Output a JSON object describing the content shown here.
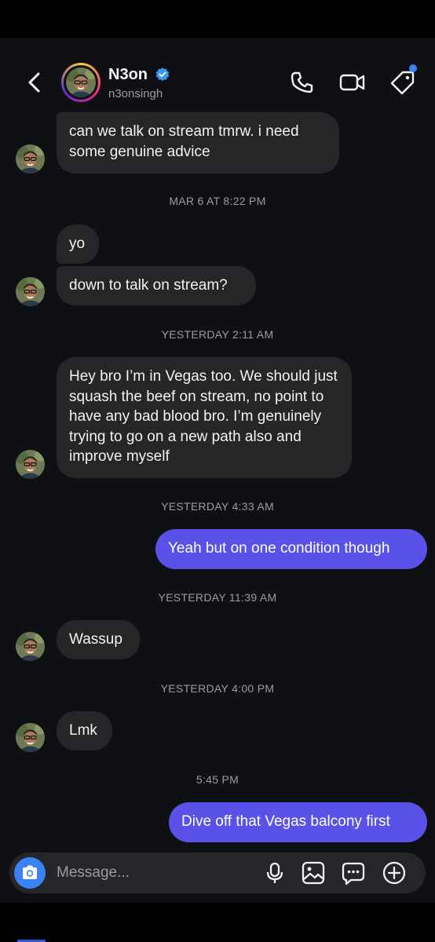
{
  "header": {
    "name": "N3on",
    "handle": "n3onsingh"
  },
  "messages": [
    {
      "dir": "in",
      "text": "can we talk on stream tmrw. i need some genuine advice"
    },
    {
      "dir": "ts",
      "text": "MAR 6 AT 8:22 PM"
    },
    {
      "dir": "in",
      "text": "yo"
    },
    {
      "dir": "in",
      "text": "down to talk on stream?"
    },
    {
      "dir": "ts",
      "text": "YESTERDAY 2:11 AM"
    },
    {
      "dir": "in",
      "text": "Hey bro I’m in Vegas too. We should just squash the beef on stream, no point to have any bad blood bro. I’m genuinely trying to go on a new path also and improve myself"
    },
    {
      "dir": "ts",
      "text": "YESTERDAY 4:33 AM"
    },
    {
      "dir": "out",
      "text": "Yeah but on one condition though"
    },
    {
      "dir": "ts",
      "text": "YESTERDAY 11:39 AM"
    },
    {
      "dir": "in",
      "text": "Wassup"
    },
    {
      "dir": "ts",
      "text": "YESTERDAY 4:00 PM"
    },
    {
      "dir": "in",
      "text": "Lmk"
    },
    {
      "dir": "ts",
      "text": "5:45 PM"
    },
    {
      "dir": "out",
      "text": "Dive off that Vegas balcony first"
    }
  ],
  "composer": {
    "placeholder": "Message..."
  },
  "colors": {
    "background": "#0f1014",
    "incoming_bubble": "#262629",
    "outgoing_bubble": "#5a51e8",
    "accent_blue": "#3b82f6"
  },
  "icons": [
    "back-arrow-icon",
    "verified-badge-icon",
    "phone-icon",
    "video-camera-icon",
    "tag-icon",
    "camera-icon",
    "microphone-icon",
    "gallery-icon",
    "sticker-chat-icon",
    "plus-circle-icon"
  ]
}
